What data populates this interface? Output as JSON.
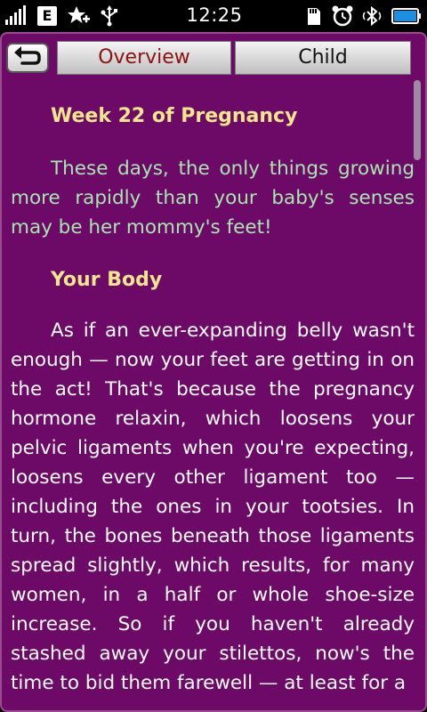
{
  "status_bar": {
    "time": "12:25",
    "network": "E",
    "icons": [
      "signal-icon",
      "edge-network-icon",
      "favorite-star-icon",
      "usb-icon",
      "sd-card-icon",
      "alarm-icon",
      "bluetooth-icon",
      "battery-icon"
    ]
  },
  "toolbar": {
    "back_icon": "back-arrow-icon",
    "tabs": [
      {
        "label": "Overview",
        "active": true,
        "color": "#8e1111"
      },
      {
        "label": "Child",
        "active": false
      }
    ]
  },
  "colors": {
    "background": "#6d0a67",
    "heading": "#f0e68c",
    "intro": "#a8e6b0",
    "body": "#ffffff"
  },
  "article": {
    "title": "Week 22 of Pregnancy",
    "intro": "These days, the only things growing more rapidly than your baby's senses may be her mommy's feet!",
    "section_heading": "Your Body",
    "body": "As if an ever-expanding belly wasn't enough — now your feet are getting in on the act! That's because the pregnancy hormone relaxin, which loosens your pelvic ligaments when you're expecting, loosens every other ligament too — including the ones in your tootsies. In turn, the bones beneath those ligaments spread slightly, which results, for many women, in a half or whole shoe-size increase. So if you haven't already stashed away your stilettos, now's the time to bid them farewell — at least for a"
  }
}
